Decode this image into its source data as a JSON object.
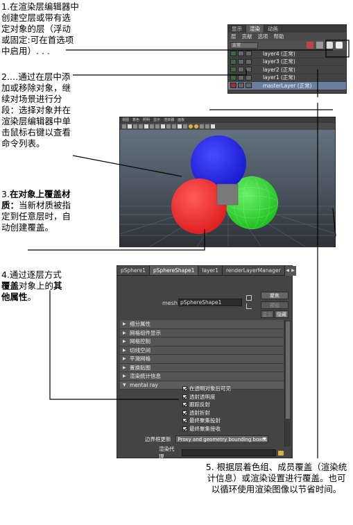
{
  "notes": {
    "n1": "1.在渲染层编辑器中创建空层或带有选定对象的层（浮动或固定:可在首选项中启用）. . .",
    "n2": "2.…通过在层中添加或移除对象，继续对场景进行分段：选择对象并在渲染层编辑器中单击鼠标右键以查看命令列表。",
    "n3_num": "3.",
    "n3_bold": "在对象上覆盖材质：",
    "n3_rest": "当新材质被指定到任意层时，自动创建覆盖。",
    "n4_a": "4.通过逐层方式",
    "n4_b": "覆盖",
    "n4_c": "对象上的",
    "n4_d": "其他属性",
    "n4_e": "。",
    "n5": "5. 根据层着色组、成员覆盖（渲染统计信息）或渲染设置进行覆盖。也可以循环使用渲染图像以节省时间。"
  },
  "layer_editor": {
    "tabs": [
      "显示",
      "渲染",
      "动画"
    ],
    "active_tab": 1,
    "menu": [
      "层",
      "贡献",
      "选项",
      "帮助"
    ],
    "dropdown": "正常",
    "layers": [
      {
        "name": "layer4 (正常)",
        "selected": false
      },
      {
        "name": "layer3 (正常)",
        "selected": false
      },
      {
        "name": "layer2 (正常)",
        "selected": false
      },
      {
        "name": "layer1 (正常)",
        "selected": false
      },
      {
        "name": "masterLayer (正常)",
        "selected": true
      }
    ]
  },
  "viewport": {
    "menu": [
      "视图",
      "着色",
      "照明",
      "显示",
      "渲染器",
      "面板"
    ],
    "spheres": [
      {
        "name": "blue",
        "color": "#1a1ad0"
      },
      {
        "name": "red",
        "color": "#e02020"
      },
      {
        "name": "green",
        "color": "#22c022"
      }
    ]
  },
  "attr_editor": {
    "tabs": [
      "pSphere1",
      "pSphereShape1",
      "layer1",
      "renderLayerManager"
    ],
    "active_tab": 1,
    "mesh_label": "mesh:",
    "mesh_value": "pSphereShape1",
    "buttons": {
      "focus": "聚焦",
      "presets": "预设",
      "show": "显示",
      "hide": "隐藏"
    },
    "sections": [
      "细分属性",
      "网格组件显示",
      "网格控制",
      "切线空间",
      "平滑网格",
      "置换贴图",
      "渲染统计信息",
      "mental ray"
    ],
    "mental_ray_options": [
      "在透明对象后可见",
      "透射透明度",
      "跟踪反射",
      "透射折射",
      "最终聚集投射",
      "最终聚集接收"
    ],
    "bbox_label": "边界框更新",
    "bbox_value": "Proxy and geometry bounding boxes",
    "proxy_label": "渲染代理"
  }
}
